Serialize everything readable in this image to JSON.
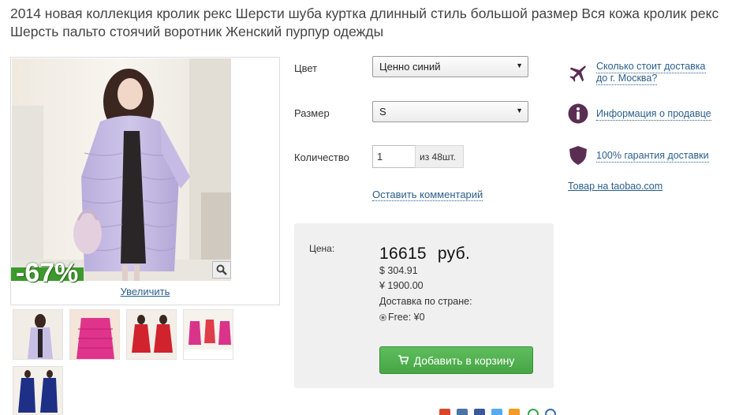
{
  "product": {
    "title": "2014 новая коллекция кролик рекс Шерсти шуба куртка длинный стиль большой размер Вся кожа кролик рекс Шерсть пальто стоячий воротник Женский пурпур одежды"
  },
  "gallery": {
    "discount_badge": "-67%",
    "enlarge_label": "Увеличить",
    "thumbnails": [
      "lavender fur coat",
      "pink fur coat",
      "red coat",
      "pink and red coats",
      "navy coat"
    ]
  },
  "options": {
    "color_label": "Цвет",
    "color_value": "Ценно синий",
    "size_label": "Размер",
    "size_value": "S",
    "quantity_label": "Количество",
    "quantity_value": "1",
    "stock_label": "из 48шт.",
    "comment_link": "Оставить комментарий"
  },
  "price": {
    "label": "Цена:",
    "rub_value": "16615",
    "rub_currency": "руб.",
    "usd": "$ 304.91",
    "cny": "¥ 1900.00",
    "shipping_label": "Доставка по стране:",
    "shipping_option": "Free: ¥0",
    "add_to_cart": "Добавить в корзину"
  },
  "info": {
    "delivery_cost_line1": "Сколько стоит доставка",
    "delivery_cost_line2": "до  г. Москва?",
    "seller_info": "Информация о продавце",
    "guarantee": "100% гарантия доставки",
    "taobao_link": "Товар на taobao.com"
  },
  "colors": {
    "link": "#2a5e8c",
    "cart_button": "#4cae4b",
    "discount_green": "#3c9a2c",
    "icon_purple": "#5a2e52",
    "price_panel_bg": "#f0f0f0"
  },
  "icons": [
    "airplane-icon",
    "info-icon",
    "shield-icon",
    "zoom-icon",
    "cart-icon"
  ]
}
